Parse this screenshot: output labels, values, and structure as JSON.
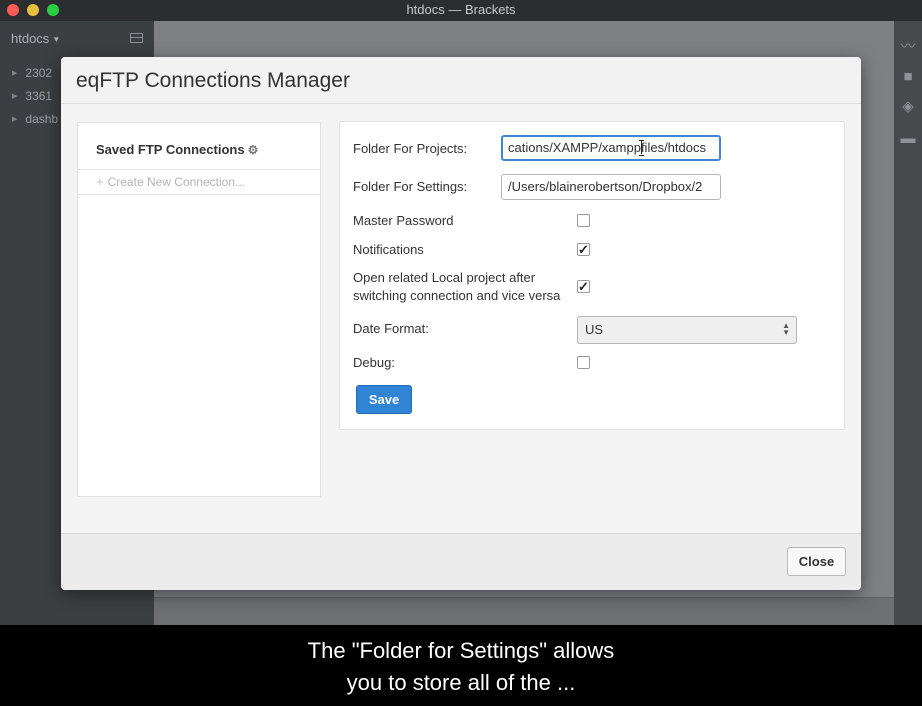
{
  "window": {
    "title": "htdocs — Brackets"
  },
  "sidebar": {
    "project": "htdocs",
    "items": [
      {
        "label": "2302"
      },
      {
        "label": "3361"
      },
      {
        "label": "dashb"
      }
    ]
  },
  "modal": {
    "title": "eqFTP Connections Manager",
    "saved_header": "Saved FTP Connections",
    "create_new": "Create New Connection...",
    "fields": {
      "folder_projects_label": "Folder For Projects:",
      "folder_projects_value": "cations/XAMPP/xamppfiles/htdocs",
      "folder_settings_label": "Folder For Settings:",
      "folder_settings_value": "/Users/blainerobertson/Dropbox/2",
      "master_password_label": "Master Password",
      "master_password_checked": false,
      "notifications_label": "Notifications",
      "notifications_checked": true,
      "open_related_label_line1": "Open related Local project after",
      "open_related_label_line2": "switching connection and vice versa",
      "open_related_checked": true,
      "date_format_label": "Date Format:",
      "date_format_value": "US",
      "debug_label": "Debug:",
      "debug_checked": false
    },
    "save_label": "Save",
    "close_label": "Close"
  },
  "caption": {
    "line1": "The \"Folder for Settings\" allows",
    "line2": "you to store all of the ..."
  },
  "icons": {
    "check": "✓",
    "gear": "⚙",
    "plus": "+"
  }
}
